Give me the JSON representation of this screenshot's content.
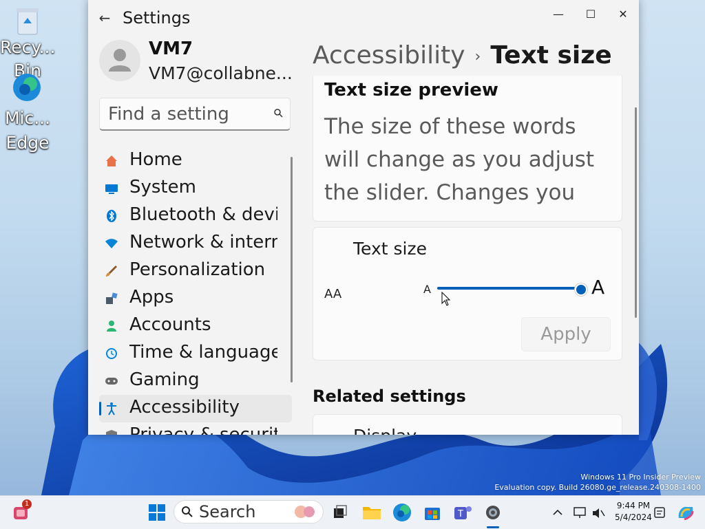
{
  "desktop": {
    "icons": [
      {
        "label_line1": "Recy...",
        "label_line2": "Bin"
      },
      {
        "label_line1": "Mic...",
        "label_line2": "Edge"
      }
    ],
    "watermark_line1": "Windows 11 Pro Insider Preview",
    "watermark_line2": "Evaluation copy. Build 26080.ge_release.240308-1400"
  },
  "window": {
    "title": "Settings",
    "controls": {
      "minimize": "—",
      "maximize": "☐",
      "close": "✕"
    }
  },
  "profile": {
    "name": "VM7",
    "email": "VM7@collabne..."
  },
  "search": {
    "placeholder": "Find a setting"
  },
  "nav": {
    "items": [
      {
        "label": "Home",
        "icon": "home-icon",
        "color": "#e8734a"
      },
      {
        "label": "System",
        "icon": "system-icon",
        "color": "#0078d4"
      },
      {
        "label": "Bluetooth & devices",
        "icon": "bluetooth-icon",
        "color": "#0078d4"
      },
      {
        "label": "Network & internet",
        "icon": "wifi-icon",
        "color": "#0a84d6"
      },
      {
        "label": "Personalization",
        "icon": "brush-icon",
        "color": "#d88c3c"
      },
      {
        "label": "Apps",
        "icon": "apps-icon",
        "color": "#4a5a6a"
      },
      {
        "label": "Accounts",
        "icon": "accounts-icon",
        "color": "#2bb673"
      },
      {
        "label": "Time & language",
        "icon": "clock-icon",
        "color": "#0a84d6"
      },
      {
        "label": "Gaming",
        "icon": "gaming-icon",
        "color": "#666666"
      },
      {
        "label": "Accessibility",
        "icon": "accessibility-icon",
        "color": "#0078d4"
      },
      {
        "label": "Privacy & security",
        "icon": "shield-icon",
        "color": "#777777"
      }
    ],
    "active_index": 9
  },
  "breadcrumb": {
    "parent": "Accessibility",
    "separator": "›",
    "current": "Text size"
  },
  "preview": {
    "title": "Text size preview",
    "text": "The size of these words will change as you adjust the slider. Changes you"
  },
  "text_size": {
    "label": "Text size",
    "icon_text": "AA",
    "slider_min_label": "A",
    "slider_max_label": "A",
    "slider_value_fraction": 1.0,
    "apply_label": "Apply"
  },
  "related": {
    "heading": "Related settings",
    "first_item": "Display"
  },
  "taskbar": {
    "search_label": "Search",
    "notification_count": "1",
    "time": "9:44 PM",
    "date": "5/4/2024",
    "accent": "#005fb8"
  }
}
